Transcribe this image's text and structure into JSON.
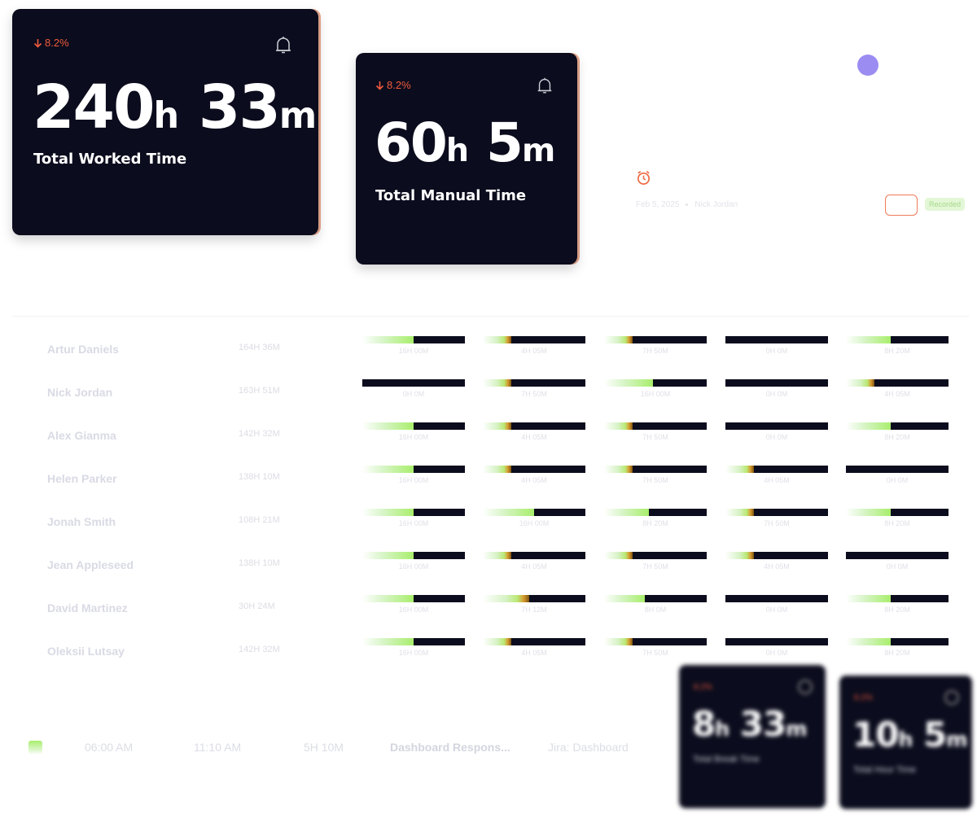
{
  "cards": {
    "worked": {
      "trend": "8.2%",
      "hours": "240",
      "h_unit": "h",
      "minutes": "33",
      "m_unit": "m",
      "caption": "Total Worked Time"
    },
    "manual": {
      "trend": "8.2%",
      "hours": "60",
      "h_unit": "h",
      "minutes": "5",
      "m_unit": "m",
      "caption": "Total Manual Time"
    },
    "break": {
      "trend": "8.2%",
      "hours": "8",
      "h_unit": "h",
      "minutes": "33",
      "m_unit": "m",
      "caption": "Total Break Time"
    },
    "hour": {
      "trend": "8.2%",
      "hours": "10",
      "h_unit": "h",
      "minutes": "5",
      "m_unit": "m",
      "caption": "Total Hour Time"
    }
  },
  "session": {
    "date": "Feb 5, 2025",
    "user": "Nick Jordan",
    "badge": "Recorded"
  },
  "colors": {
    "card_bg": "#0b0c1d",
    "trend_down": "#ef5a3c",
    "accent_purple": "#9b8cf2",
    "progress_green": "#a8ee6c",
    "progress_orange": "#d69a2e"
  },
  "timesheet": {
    "rows": [
      {
        "name": "Artur Daniels",
        "total": "164H 36M",
        "days": [
          {
            "label": "16H 00M",
            "progress": 0.5,
            "style": "green"
          },
          {
            "label": "4H 05M",
            "progress": 0.28,
            "style": "orange"
          },
          {
            "label": "7H 50M",
            "progress": 0.28,
            "style": "orange"
          },
          {
            "label": "0H 0M",
            "progress": 0,
            "style": "green"
          },
          {
            "label": "8H 20M",
            "progress": 0.44,
            "style": "green"
          }
        ]
      },
      {
        "name": "Nick Jordan",
        "total": "163H 51M",
        "days": [
          {
            "label": "0H 0M",
            "progress": 0,
            "style": "green"
          },
          {
            "label": "7H 50M",
            "progress": 0.28,
            "style": "orange"
          },
          {
            "label": "16H 00M",
            "progress": 0.48,
            "style": "green"
          },
          {
            "label": "0H 0M",
            "progress": 0,
            "style": "green"
          },
          {
            "label": "4H 05M",
            "progress": 0.28,
            "style": "orange"
          }
        ]
      },
      {
        "name": "Alex Gianma",
        "total": "142H 32M",
        "days": [
          {
            "label": "16H 00M",
            "progress": 0.5,
            "style": "green"
          },
          {
            "label": "4H 05M",
            "progress": 0.28,
            "style": "orange"
          },
          {
            "label": "7H 50M",
            "progress": 0.28,
            "style": "orange"
          },
          {
            "label": "0H 0M",
            "progress": 0,
            "style": "green"
          },
          {
            "label": "8H 20M",
            "progress": 0.44,
            "style": "green"
          }
        ]
      },
      {
        "name": "Helen Parker",
        "total": "138H 10M",
        "days": [
          {
            "label": "16H 00M",
            "progress": 0.5,
            "style": "green"
          },
          {
            "label": "4H 05M",
            "progress": 0.28,
            "style": "orange"
          },
          {
            "label": "7H 50M",
            "progress": 0.28,
            "style": "orange"
          },
          {
            "label": "4H 05M",
            "progress": 0.28,
            "style": "orange"
          },
          {
            "label": "0H 0M",
            "progress": 0,
            "style": "green"
          }
        ]
      },
      {
        "name": "Jonah Smith",
        "total": "108H 21M",
        "days": [
          {
            "label": "16H 00M",
            "progress": 0.5,
            "style": "green"
          },
          {
            "label": "16H 00M",
            "progress": 0.5,
            "style": "green"
          },
          {
            "label": "8H 20M",
            "progress": 0.44,
            "style": "green"
          },
          {
            "label": "7H 50M",
            "progress": 0.28,
            "style": "orange"
          },
          {
            "label": "8H 20M",
            "progress": 0.44,
            "style": "green"
          }
        ]
      },
      {
        "name": "Jean Appleseed",
        "total": "138H 10M",
        "days": [
          {
            "label": "16H 00M",
            "progress": 0.5,
            "style": "green"
          },
          {
            "label": "4H 05M",
            "progress": 0.28,
            "style": "orange"
          },
          {
            "label": "7H 50M",
            "progress": 0.28,
            "style": "orange"
          },
          {
            "label": "4H 05M",
            "progress": 0.28,
            "style": "orange"
          },
          {
            "label": "0H 0M",
            "progress": 0,
            "style": "green"
          }
        ]
      },
      {
        "name": "David Martinez",
        "total": "30H 24M",
        "days": [
          {
            "label": "16H 00M",
            "progress": 0.5,
            "style": "green"
          },
          {
            "label": "7H 12M",
            "progress": 0.45,
            "style": "orange"
          },
          {
            "label": "8H 0M",
            "progress": 0.4,
            "style": "green"
          },
          {
            "label": "0H 0M",
            "progress": 0,
            "style": "green"
          },
          {
            "label": "8H 20M",
            "progress": 0.44,
            "style": "green"
          }
        ]
      },
      {
        "name": "Oleksii Lutsay",
        "total": "142H 32M",
        "days": [
          {
            "label": "16H 00M",
            "progress": 0.5,
            "style": "green"
          },
          {
            "label": "4H 05M",
            "progress": 0.28,
            "style": "orange"
          },
          {
            "label": "7H 50M",
            "progress": 0.28,
            "style": "orange"
          },
          {
            "label": "0H 0M",
            "progress": 0,
            "style": "green"
          },
          {
            "label": "8H 20M",
            "progress": 0.44,
            "style": "green"
          }
        ]
      }
    ]
  },
  "activity": {
    "start": "06:00 AM",
    "end": "11:10 AM",
    "duration": "5H 10M",
    "task": "Dashboard Respons...",
    "source": "Jira: Dashboard"
  }
}
